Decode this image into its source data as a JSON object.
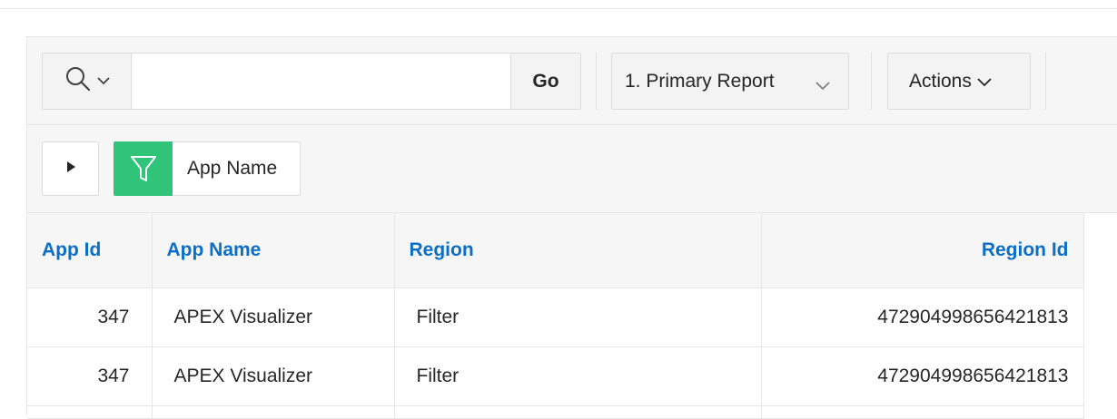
{
  "toolbar": {
    "search_placeholder": "",
    "search_value": "",
    "go_label": "Go",
    "report_select": "1. Primary Report",
    "actions_label": "Actions"
  },
  "filters": {
    "chip_label": "App Name"
  },
  "table": {
    "headers": {
      "app_id": "App Id",
      "app_name": "App Name",
      "region": "Region",
      "region_id": "Region Id"
    },
    "rows": [
      {
        "app_id": "347",
        "app_name": "APEX Visualizer",
        "region": "Filter",
        "region_id": "472904998656421813"
      },
      {
        "app_id": "347",
        "app_name": "APEX Visualizer",
        "region": "Filter",
        "region_id": "472904998656421813"
      }
    ]
  },
  "colors": {
    "accent_green": "#2fc47a",
    "header_blue": "#0b6fc7"
  },
  "icons": {
    "search": "search-icon",
    "chevron": "chevron-down-icon",
    "expand": "triangle-right-icon",
    "filter": "funnel-icon"
  }
}
